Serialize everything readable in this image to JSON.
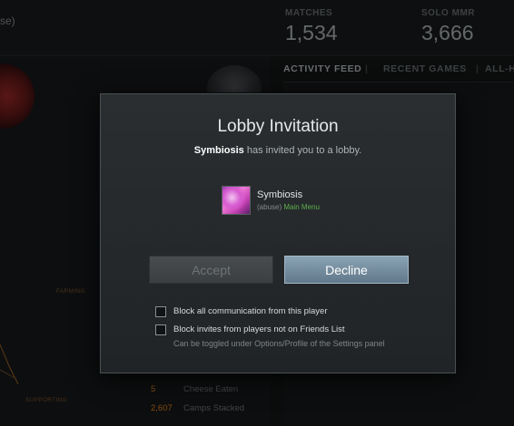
{
  "background": {
    "user_name_fragment": "se)",
    "stats": {
      "matches_label": "MATCHES",
      "matches_value": "1,534",
      "solo_mmr_label": "SOLO MMR",
      "solo_mmr_value": "3,666"
    },
    "tabs": [
      {
        "label": "ACTIVITY FEED"
      },
      {
        "label": "RECENT GAMES"
      },
      {
        "label": "ALL-H"
      }
    ],
    "tab_separator": "|",
    "roles": {
      "farming": "FARMING",
      "supporting": "SUPPORTING"
    },
    "stat_rows": [
      {
        "value": "5",
        "label": "Cheese Eaten"
      },
      {
        "value": "2,607",
        "label": "Camps Stacked"
      }
    ]
  },
  "modal": {
    "title": "Lobby Invitation",
    "inviter_name": "Symbiosis",
    "invite_text": "has invited you to a lobby.",
    "player": {
      "name": "Symbiosis",
      "tag": "(abuse)",
      "status": "Main Menu"
    },
    "buttons": {
      "accept": "Accept",
      "decline": "Decline"
    },
    "checkboxes": [
      {
        "label": "Block all communication from this player",
        "checked": false
      },
      {
        "label": "Block invites from players not on Friends List",
        "checked": false
      }
    ],
    "hint": "Can be toggled under Options/Profile of the Settings panel"
  },
  "colors": {
    "decline_button": "#7891a3",
    "status_online": "#5fae4e",
    "stat_number": "#c7781f"
  }
}
